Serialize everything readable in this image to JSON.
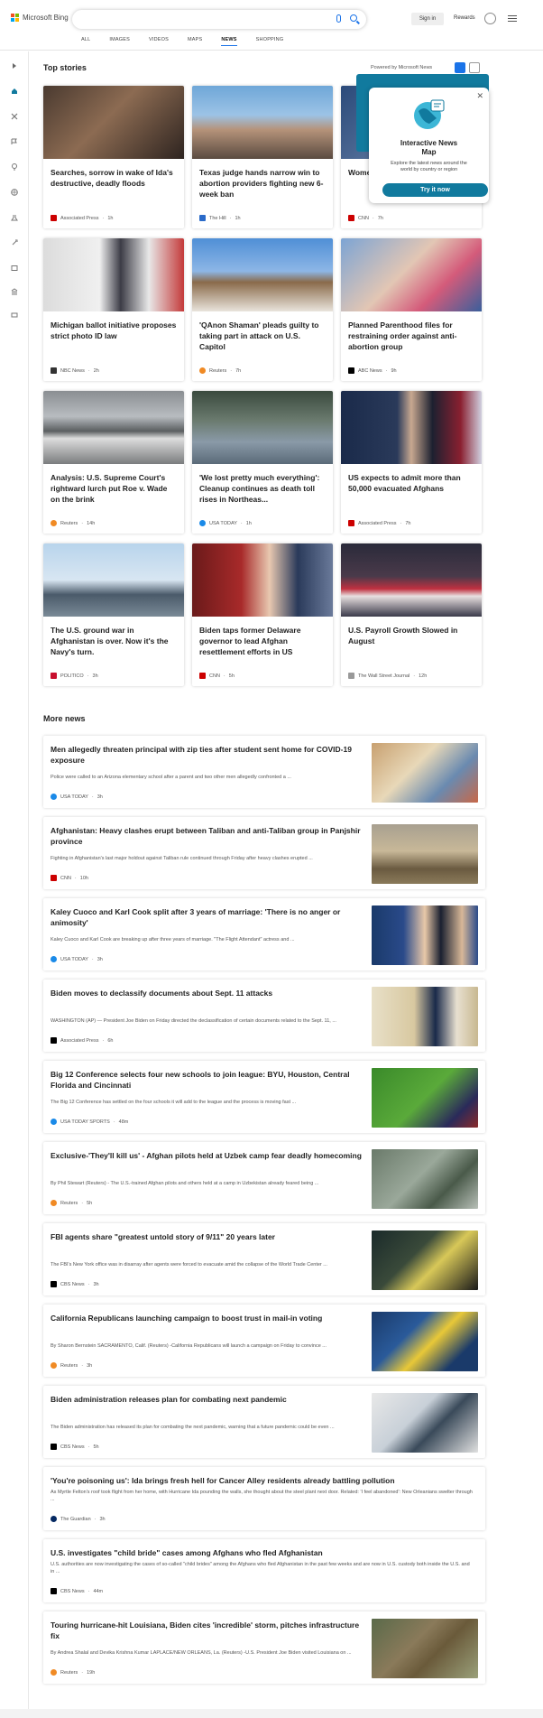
{
  "header": {
    "brand": "Microsoft Bing",
    "search_placeholder": "",
    "signin": "Sign in",
    "rewards": "Rewards",
    "tabs": [
      "ALL",
      "IMAGES",
      "VIDEOS",
      "MAPS",
      "NEWS",
      "SHOPPING"
    ],
    "active_tab": "NEWS"
  },
  "top_stories": {
    "heading": "Top stories",
    "powered": "Powered by Microsoft News",
    "cards": [
      {
        "title": "Searches, sorrow in wake of Ida's destructive, deadly floods",
        "source": "Associated Press",
        "time": "1h"
      },
      {
        "title": "Texas judge hands narrow win to abortion providers fighting new 6-week ban",
        "source": "The Hill",
        "time": "1h"
      },
      {
        "title": "Women Taliba",
        "source": "CNN",
        "time": "7h"
      },
      {
        "title": "Michigan ballot initiative proposes strict photo ID law",
        "source": "NBC News",
        "time": "2h"
      },
      {
        "title": "'QAnon Shaman' pleads guilty to taking part in attack on U.S. Capitol",
        "source": "Reuters",
        "time": "7h"
      },
      {
        "title": "Planned Parenthood files for restraining order against anti-abortion group",
        "source": "ABC News",
        "time": "9h"
      },
      {
        "title": "Analysis: U.S. Supreme Court's rightward lurch put Roe v. Wade on the brink",
        "source": "Reuters",
        "time": "14h"
      },
      {
        "title": "'We lost pretty much everything': Cleanup continues as death toll rises in Northeas...",
        "source": "USA TODAY",
        "time": "1h"
      },
      {
        "title": "US expects to admit more than 50,000 evacuated Afghans",
        "source": "Associated Press",
        "time": "7h"
      },
      {
        "title": "The U.S. ground war in Afghanistan is over. Now it's the Navy's turn.",
        "source": "POLITICO",
        "time": "3h"
      },
      {
        "title": "Biden taps former Delaware governor to lead Afghan resettlement efforts in US",
        "source": "CNN",
        "time": "5h"
      },
      {
        "title": "U.S. Payroll Growth Slowed in August",
        "source": "The Wall Street Journal",
        "time": "12h"
      }
    ]
  },
  "popup": {
    "title": "Interactive News Map",
    "description": "Explore the latest news around the world by country or region",
    "button": "Try it now"
  },
  "more_news": {
    "heading": "More news",
    "items": [
      {
        "title": "Men allegedly threaten principal with zip ties after student sent home for COVID-19 exposure",
        "desc": "Police were called to an Arizona elementary school after a parent and two other men allegedly confronted a ...",
        "source": "USA TODAY",
        "time": "3h"
      },
      {
        "title": "Afghanistan: Heavy clashes erupt between Taliban and anti-Taliban group in Panjshir province",
        "desc": "Fighting in Afghanistan's last major holdout against Taliban rule continued through Friday after heavy clashes erupted ...",
        "source": "CNN",
        "time": "10h"
      },
      {
        "title": "Kaley Cuoco and Karl Cook split after 3 years of marriage: 'There is no anger or animosity'",
        "desc": "Kaley Cuoco and Karl Cook are breaking up after three years of marriage. \"The Flight Attendant\" actress and ...",
        "source": "USA TODAY",
        "time": "3h"
      },
      {
        "title": "Biden moves to declassify documents about Sept. 11 attacks",
        "desc": "WASHINGTON (AP) — President Joe Biden on Friday directed the declassification of certain documents related to the Sept. 11, ...",
        "source": "Associated Press",
        "time": "6h"
      },
      {
        "title": "Big 12 Conference selects four new schools to join league: BYU, Houston, Central Florida and Cincinnati",
        "desc": "The Big 12 Conference has settled on the four schools it will add to the league and the process is moving fast ...",
        "source": "USA TODAY SPORTS",
        "time": "48m"
      },
      {
        "title": "Exclusive-'They'll kill us' - Afghan pilots held at Uzbek camp fear deadly homecoming",
        "desc": "By Phil Stewart (Reuters) - The U.S.-trained Afghan pilots and others held at a camp in Uzbekistan already feared being ...",
        "source": "Reuters",
        "time": "5h"
      },
      {
        "title": "FBI agents share \"greatest untold story of 9/11\" 20 years later",
        "desc": "The FBI's New York office was in disarray after agents were forced to evacuate amid the collapse of the World Trade Center ...",
        "source": "CBS News",
        "time": "3h"
      },
      {
        "title": "California Republicans launching campaign to boost trust in mail-in voting",
        "desc": "By Sharon Bernstein SACRAMENTO, Calif. (Reuters) -California Republicans will launch a campaign on Friday to convince ...",
        "source": "Reuters",
        "time": "3h"
      },
      {
        "title": "Biden administration releases plan for combating next pandemic",
        "desc": "The Biden administration has released its plan for combating the next pandemic, warning that a future pandemic could be even ...",
        "source": "CBS News",
        "time": "5h"
      },
      {
        "title": "'You're poisoning us': Ida brings fresh hell for Cancer Alley residents already battling pollution",
        "desc": "As Myrtle Felton's roof took flight from her home, with Hurricane Ida pounding the walls, she thought about the steel plant next door. Related: 'I feel abandoned': New Orleanians swelter through ...",
        "source": "The Guardian",
        "time": "3h"
      },
      {
        "title": "U.S. investigates \"child bride\" cases among Afghans who fled Afghanistan",
        "desc": "U.S. authorities are now investigating the cases of so-called \"child brides\" among the Afghans who fled Afghanistan in the past few weeks and are now in U.S. custody both inside the U.S. and in ...",
        "source": "CBS News",
        "time": "44m"
      },
      {
        "title": "Touring hurricane-hit Louisiana, Biden cites 'incredible' storm, pitches infrastructure fix",
        "desc": "By Andrea Shalal and Devika Krishna Kumar LAPLACE/NEW ORLEANS, La. (Reuters) -U.S. President Joe Biden visited Louisiana on ...",
        "source": "Reuters",
        "time": "19h"
      }
    ]
  },
  "colors": {
    "accent": "#1a73e8",
    "teal": "#117a9e"
  }
}
